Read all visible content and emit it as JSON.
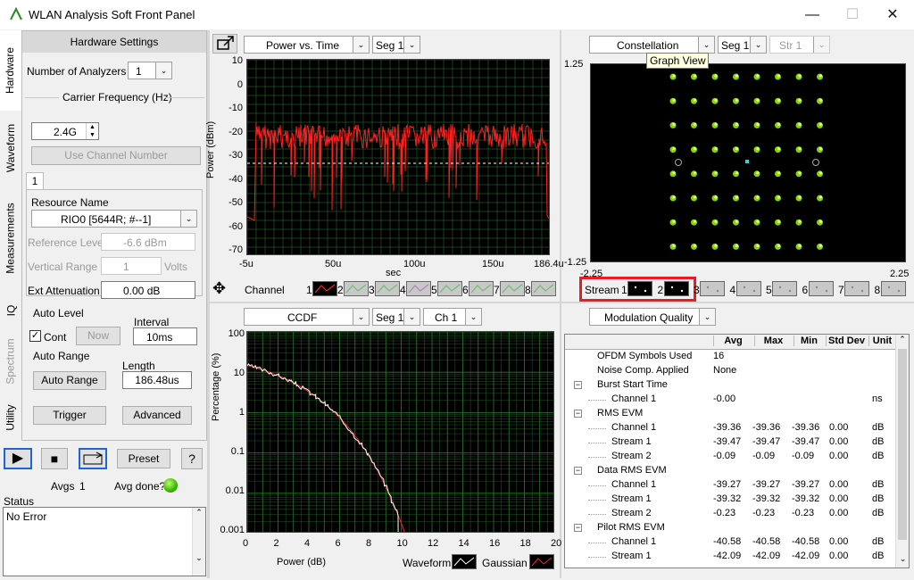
{
  "window": {
    "title": "WLAN Analysis Soft Front Panel"
  },
  "left_tabs": [
    "Hardware",
    "Waveform",
    "Measurements",
    "IQ",
    "Spectrum",
    "Utility"
  ],
  "hardware": {
    "header": "Hardware Settings",
    "num_analyzers_label": "Number of Analyzers",
    "num_analyzers": "1",
    "carrier_freq_label": "Carrier Frequency (Hz)",
    "carrier_freq": "2.4G",
    "use_channel_btn": "Use Channel Number",
    "channel_tab": "1",
    "resource_name_label": "Resource Name",
    "resource_name": "RIO0 [5644R; #--1]",
    "ref_level_label": "Reference Level",
    "ref_level": "-6.6 dBm",
    "vert_range_label": "Vertical Range",
    "vert_range": "1",
    "vert_unit": "Volts",
    "ext_atten_label": "Ext Attenuation",
    "ext_atten": "0.00 dB",
    "auto_level_label": "Auto Level",
    "interval_label": "Interval",
    "cont_label": "Cont",
    "now_btn": "Now",
    "interval": "10ms",
    "auto_range_label": "Auto Range",
    "length_label": "Length",
    "auto_range_btn": "Auto Range",
    "length": "186.48us",
    "trigger_btn": "Trigger",
    "advanced_btn": "Advanced"
  },
  "controls": {
    "preset_btn": "Preset",
    "help_btn": "?",
    "avgs_label": "Avgs",
    "avgs": "1",
    "avg_done_label": "Avg done?",
    "status_label": "Status",
    "status_text": "No Error"
  },
  "pvt": {
    "view": "Power vs. Time",
    "seg": "Seg 1",
    "ylabel": "Power (dBm)",
    "xlabel": "sec",
    "yticks": [
      "10",
      "0",
      "-10",
      "-20",
      "-30",
      "-40",
      "-50",
      "-60",
      "-70"
    ],
    "xticks": [
      "-5u",
      "50u",
      "100u",
      "150u",
      "186.4u"
    ],
    "legend_label": "Channel",
    "legend_items": [
      "1",
      "2",
      "3",
      "4",
      "5",
      "6",
      "7",
      "8"
    ]
  },
  "constellation": {
    "view": "Constellation",
    "seg": "Seg 1",
    "str": "Str 1",
    "tooltip": "Graph View",
    "ymax": "1.25",
    "ymin": "-1.25",
    "xmin": "-2.25",
    "xmax": "2.25",
    "stream_label": "Stream",
    "streams": [
      "1",
      "2",
      "3",
      "4",
      "5",
      "6",
      "7",
      "8"
    ]
  },
  "ccdf": {
    "view": "CCDF",
    "seg": "Seg 1",
    "ch": "Ch 1",
    "ylabel": "Percentage (%)",
    "xlabel": "Power (dB)",
    "yticks": [
      "100",
      "10",
      "1",
      "0.1",
      "0.01",
      "0.001"
    ],
    "xticks": [
      "0",
      "2",
      "4",
      "6",
      "8",
      "10",
      "12",
      "14",
      "16",
      "18",
      "20"
    ],
    "legend_waveform": "Waveform",
    "legend_gaussian": "Gaussian"
  },
  "modq": {
    "view": "Modulation Quality",
    "columns": [
      "Avg",
      "Max",
      "Min",
      "Std Dev",
      "Unit"
    ],
    "rows": [
      {
        "label": "OFDM Symbols Used",
        "indent": 1,
        "avg": "16",
        "max": "",
        "min": "",
        "std": "",
        "unit": ""
      },
      {
        "label": "Noise Comp. Applied",
        "indent": 1,
        "avg": "None",
        "max": "",
        "min": "",
        "std": "",
        "unit": ""
      },
      {
        "label": "Burst Start Time",
        "indent": 0,
        "avg": "",
        "max": "",
        "min": "",
        "std": "",
        "unit": ""
      },
      {
        "label": "Channel 1",
        "indent": 2,
        "avg": "-0.00",
        "max": "",
        "min": "",
        "std": "",
        "unit": "ns"
      },
      {
        "label": "RMS EVM",
        "indent": 0,
        "avg": "",
        "max": "",
        "min": "",
        "std": "",
        "unit": ""
      },
      {
        "label": "Channel 1",
        "indent": 2,
        "avg": "-39.36",
        "max": "-39.36",
        "min": "-39.36",
        "std": "0.00",
        "unit": "dB"
      },
      {
        "label": "Stream 1",
        "indent": 2,
        "avg": "-39.47",
        "max": "-39.47",
        "min": "-39.47",
        "std": "0.00",
        "unit": "dB"
      },
      {
        "label": "Stream 2",
        "indent": 2,
        "avg": "-0.09",
        "max": "-0.09",
        "min": "-0.09",
        "std": "0.00",
        "unit": "dB"
      },
      {
        "label": "Data RMS EVM",
        "indent": 0,
        "avg": "",
        "max": "",
        "min": "",
        "std": "",
        "unit": ""
      },
      {
        "label": "Channel 1",
        "indent": 2,
        "avg": "-39.27",
        "max": "-39.27",
        "min": "-39.27",
        "std": "0.00",
        "unit": "dB"
      },
      {
        "label": "Stream 1",
        "indent": 2,
        "avg": "-39.32",
        "max": "-39.32",
        "min": "-39.32",
        "std": "0.00",
        "unit": "dB"
      },
      {
        "label": "Stream 2",
        "indent": 2,
        "avg": "-0.23",
        "max": "-0.23",
        "min": "-0.23",
        "std": "0.00",
        "unit": "dB"
      },
      {
        "label": "Pilot RMS EVM",
        "indent": 0,
        "avg": "",
        "max": "",
        "min": "",
        "std": "",
        "unit": ""
      },
      {
        "label": "Channel 1",
        "indent": 2,
        "avg": "-40.58",
        "max": "-40.58",
        "min": "-40.58",
        "std": "0.00",
        "unit": "dB"
      },
      {
        "label": "Stream 1",
        "indent": 2,
        "avg": "-42.09",
        "max": "-42.09",
        "min": "-42.09",
        "std": "0.00",
        "unit": "dB"
      }
    ]
  },
  "colors": {
    "plot_bg": "#000000",
    "grid": "#2f7a2f",
    "trace": "#ff2020",
    "const_point": "#8bd400",
    "highlight": "#e81c24"
  }
}
